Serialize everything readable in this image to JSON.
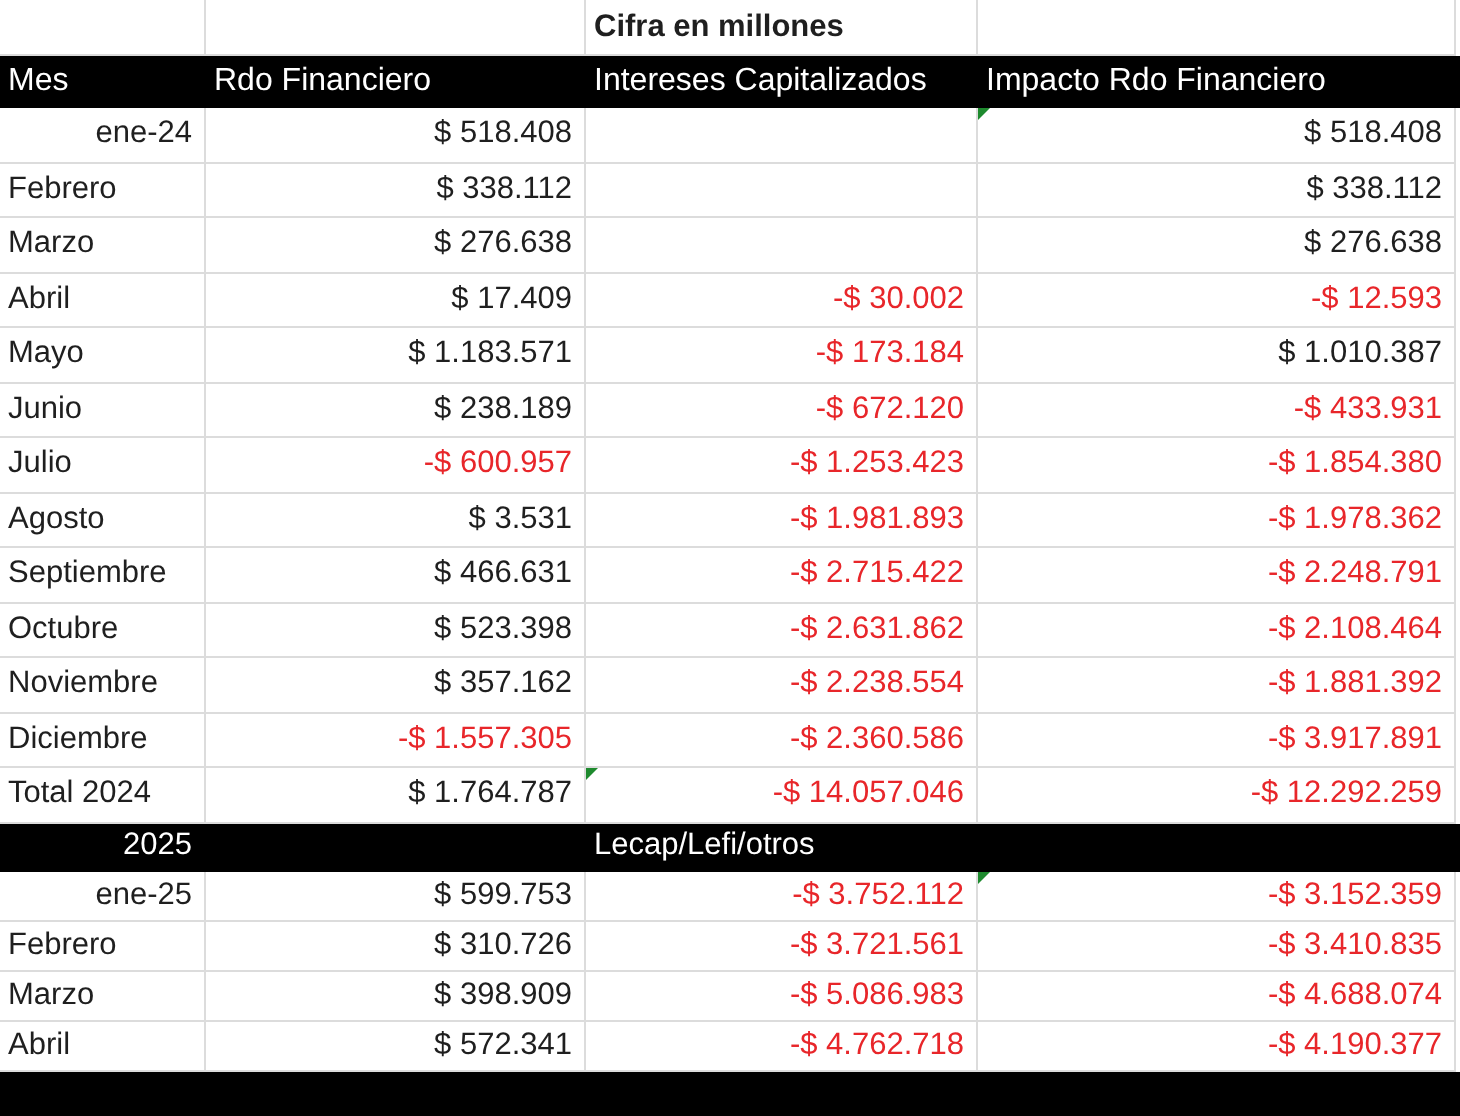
{
  "caption_row": {
    "caption": "Cifra en millones"
  },
  "columns": [
    "Mes",
    "Rdo Financiero",
    "Intereses Capitalizados",
    "Impacto Rdo Financiero"
  ],
  "rows_2024": [
    {
      "label": "ene-24",
      "kind": "date",
      "cells": [
        {
          "text": "$ 518.408",
          "negative": false,
          "flag": false
        },
        null,
        {
          "text": "$ 518.408",
          "negative": false,
          "flag": true
        }
      ]
    },
    {
      "label": "Febrero",
      "kind": "text",
      "cells": [
        {
          "text": "$ 338.112",
          "negative": false,
          "flag": false
        },
        null,
        {
          "text": "$ 338.112",
          "negative": false,
          "flag": false
        }
      ]
    },
    {
      "label": "Marzo",
      "kind": "text",
      "cells": [
        {
          "text": "$ 276.638",
          "negative": false,
          "flag": false
        },
        null,
        {
          "text": "$ 276.638",
          "negative": false,
          "flag": false
        }
      ]
    },
    {
      "label": "Abril",
      "kind": "text",
      "cells": [
        {
          "text": "$ 17.409",
          "negative": false,
          "flag": false
        },
        {
          "text": "-$ 30.002",
          "negative": true,
          "flag": false
        },
        {
          "text": "-$ 12.593",
          "negative": true,
          "flag": false
        }
      ]
    },
    {
      "label": "Mayo",
      "kind": "text",
      "cells": [
        {
          "text": "$ 1.183.571",
          "negative": false,
          "flag": false
        },
        {
          "text": "-$ 173.184",
          "negative": true,
          "flag": false
        },
        {
          "text": "$ 1.010.387",
          "negative": false,
          "flag": false
        }
      ]
    },
    {
      "label": "Junio",
      "kind": "text",
      "cells": [
        {
          "text": "$ 238.189",
          "negative": false,
          "flag": false
        },
        {
          "text": "-$ 672.120",
          "negative": true,
          "flag": false
        },
        {
          "text": "-$ 433.931",
          "negative": true,
          "flag": false
        }
      ]
    },
    {
      "label": "Julio",
      "kind": "text",
      "cells": [
        {
          "text": "-$ 600.957",
          "negative": true,
          "flag": false
        },
        {
          "text": "-$ 1.253.423",
          "negative": true,
          "flag": false
        },
        {
          "text": "-$ 1.854.380",
          "negative": true,
          "flag": false
        }
      ]
    },
    {
      "label": "Agosto",
      "kind": "text",
      "cells": [
        {
          "text": "$ 3.531",
          "negative": false,
          "flag": false
        },
        {
          "text": "-$ 1.981.893",
          "negative": true,
          "flag": false
        },
        {
          "text": "-$ 1.978.362",
          "negative": true,
          "flag": false
        }
      ]
    },
    {
      "label": "Septiembre",
      "kind": "text",
      "cells": [
        {
          "text": "$ 466.631",
          "negative": false,
          "flag": false
        },
        {
          "text": "-$ 2.715.422",
          "negative": true,
          "flag": false
        },
        {
          "text": "-$ 2.248.791",
          "negative": true,
          "flag": false
        }
      ]
    },
    {
      "label": "Octubre",
      "kind": "text",
      "cells": [
        {
          "text": "$ 523.398",
          "negative": false,
          "flag": false
        },
        {
          "text": "-$ 2.631.862",
          "negative": true,
          "flag": false
        },
        {
          "text": "-$ 2.108.464",
          "negative": true,
          "flag": false
        }
      ]
    },
    {
      "label": "Noviembre",
      "kind": "text",
      "cells": [
        {
          "text": "$ 357.162",
          "negative": false,
          "flag": false
        },
        {
          "text": "-$ 2.238.554",
          "negative": true,
          "flag": false
        },
        {
          "text": "-$ 1.881.392",
          "negative": true,
          "flag": false
        }
      ]
    },
    {
      "label": "Diciembre",
      "kind": "text",
      "cells": [
        {
          "text": "-$ 1.557.305",
          "negative": true,
          "flag": false
        },
        {
          "text": "-$ 2.360.586",
          "negative": true,
          "flag": false
        },
        {
          "text": "-$ 3.917.891",
          "negative": true,
          "flag": false
        }
      ]
    },
    {
      "label": "Total 2024",
      "kind": "text",
      "cells": [
        {
          "text": "$ 1.764.787",
          "negative": false,
          "flag": false
        },
        {
          "text": "-$ 14.057.046",
          "negative": true,
          "flag": true
        },
        {
          "text": "-$ 12.292.259",
          "negative": true,
          "flag": false
        }
      ]
    }
  ],
  "section": {
    "year": "2025",
    "caption": "Lecap/Lefi/otros"
  },
  "rows_2025": [
    {
      "label": "ene-25",
      "kind": "date",
      "cells": [
        {
          "text": "$ 599.753",
          "negative": false,
          "flag": false
        },
        {
          "text": "-$ 3.752.112",
          "negative": true,
          "flag": false
        },
        {
          "text": "-$ 3.152.359",
          "negative": true,
          "flag": true
        }
      ]
    },
    {
      "label": "Febrero",
      "kind": "text",
      "cells": [
        {
          "text": "$ 310.726",
          "negative": false,
          "flag": false
        },
        {
          "text": "-$ 3.721.561",
          "negative": true,
          "flag": false
        },
        {
          "text": "-$ 3.410.835",
          "negative": true,
          "flag": false
        }
      ]
    },
    {
      "label": "Marzo",
      "kind": "text",
      "cells": [
        {
          "text": "$ 398.909",
          "negative": false,
          "flag": false
        },
        {
          "text": "-$ 5.086.983",
          "negative": true,
          "flag": false
        },
        {
          "text": "-$ 4.688.074",
          "negative": true,
          "flag": false
        }
      ]
    },
    {
      "label": "Abril",
      "kind": "text",
      "cells": [
        {
          "text": "$ 572.341",
          "negative": false,
          "flag": false
        },
        {
          "text": "-$ 4.762.718",
          "negative": true,
          "flag": false
        },
        {
          "text": "-$ 4.190.377",
          "negative": true,
          "flag": false
        }
      ]
    }
  ]
}
